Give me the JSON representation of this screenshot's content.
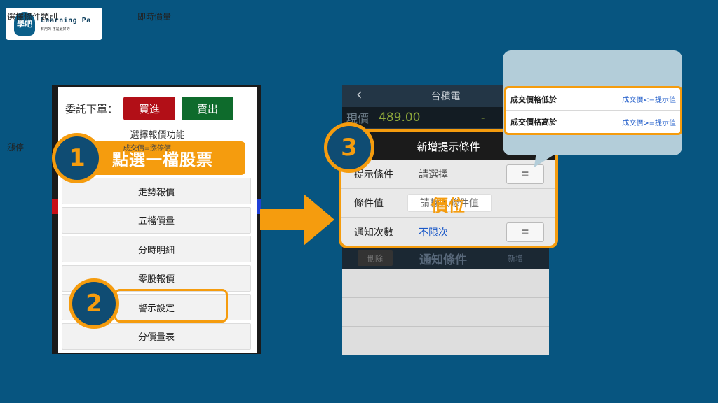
{
  "logo": {
    "mark": "學吧",
    "name": "Learning Pa",
    "slogan": "有用的 才是最好的"
  },
  "left": {
    "order_label": "委託下單：",
    "buy_label": "買進",
    "sell_label": "賣出",
    "quote_title": "選擇報價功能",
    "menu": [
      "走勢報價",
      "五檔價量",
      "分時明細",
      "零股報價",
      "警示設定",
      "分價量表"
    ]
  },
  "steps": {
    "step1_number": "1",
    "step1_text": "點選一檔股票",
    "step2_number": "2",
    "step3_number": "3"
  },
  "right": {
    "stock_name": "台積電",
    "back_icon": "‹",
    "price_label": "現價",
    "price_value": "489.00",
    "price_change": "-",
    "delete_label": "刪除",
    "notify_title": "通知條件",
    "add_label": "新增"
  },
  "dialog": {
    "title": "新增提示條件",
    "rows": [
      {
        "label": "提示條件",
        "value": "請選擇"
      },
      {
        "label": "條件值",
        "value": "請輸入條件值",
        "overlay": "價位"
      },
      {
        "label": "通知次數",
        "value": "不限次"
      }
    ],
    "menu_icon": "≡"
  },
  "popup": {
    "head_left": "選擇條件類別",
    "head_right": "即時價量",
    "items": [
      {
        "left": "成交價格低於",
        "right": "成交價<=提示值"
      },
      {
        "left": "成交價格高於",
        "right": "成交價>=提示值"
      }
    ],
    "last_left": "漲停",
    "last_right": "成交價=漲停價"
  },
  "colors": {
    "background": "#075580",
    "accent": "#f59c0e",
    "buy": "#b20f17",
    "sell": "#0e6b2c"
  }
}
